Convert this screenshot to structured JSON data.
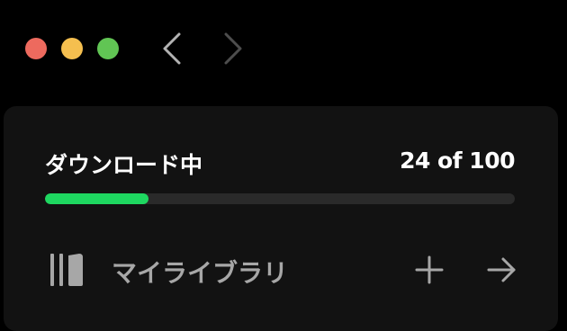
{
  "window": {
    "controls": {
      "close_color": "#ed6a5e",
      "minimize_color": "#f5bf4f",
      "zoom_color": "#61c554"
    },
    "nav": {
      "back_icon": "chevron-left-icon",
      "forward_icon": "chevron-right-icon",
      "forward_enabled": false
    }
  },
  "download": {
    "title": "ダウンロード中",
    "count_text": "24 of 100",
    "current": 24,
    "total": 100,
    "progress_fraction": 0.22,
    "accent_color": "#1ed760"
  },
  "library": {
    "icon": "library-icon",
    "label": "マイライブラリ",
    "add_icon": "plus-icon",
    "expand_icon": "arrow-right-icon"
  }
}
